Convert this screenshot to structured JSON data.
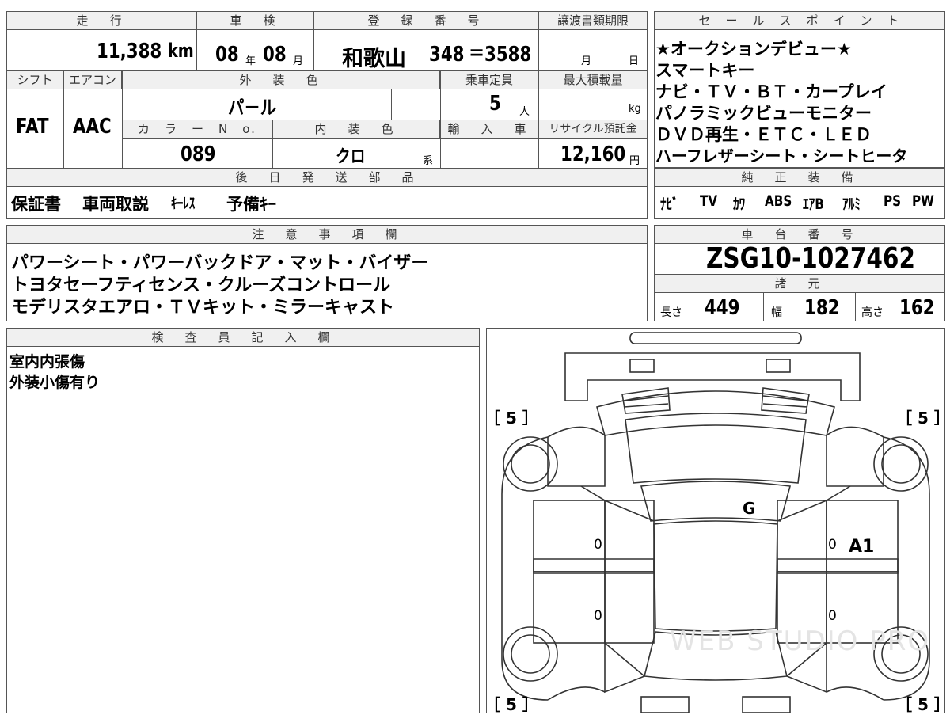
{
  "top": {
    "mileage_hdr": "走　行",
    "mileage": "11,388",
    "mileage_unit": "km",
    "inspection_hdr": "車　検",
    "insp_year": "08",
    "insp_year_unit": "年",
    "insp_month": "08",
    "insp_month_unit": "月",
    "reg_hdr": "登　録　番　号",
    "reg_area": "和歌山",
    "reg_class": "348",
    "reg_sep": "=",
    "reg_number": "3588",
    "transfer_hdr": "譲渡書類期限",
    "transfer_month": "月",
    "transfer_day": "日",
    "shift_hdr": "シフト",
    "shift": "FAT",
    "ac_hdr": "エアコン",
    "ac": "AAC",
    "exterior_hdr": "外　装　色",
    "exterior": "パ－ル",
    "capacity_hdr": "乗車定員",
    "capacity": "5",
    "capacity_unit": "人",
    "maxload_hdr": "最大積載量",
    "maxload_unit": "kg",
    "color_no_hdr": "カ　ラ　ー　N　o.",
    "color_no": "089",
    "interior_hdr": "内　装　色",
    "interior": "クロ",
    "interior_unit": "系",
    "import_hdr": "輸　入　車",
    "recycle_hdr": "リサイクル預託金",
    "recycle": "12,160",
    "recycle_unit": "円",
    "later_parts_hdr": "後　日　発　送　部　品",
    "later_parts": [
      "保証書",
      "車両取説",
      "ｷｰﾚｽ",
      "予備ｷｰ"
    ]
  },
  "sales": {
    "hdr": "セ　ー　ル　ス　ポ　イ　ン　ト",
    "lines": [
      "★オークションデビュー★",
      "スマートキー",
      "ナビ・ＴＶ・ＢＴ・カープレイ",
      "パノラミックビューモニター",
      "ＤＶＤ再生・ＥＴＣ・ＬＥＤ",
      "ハーフレザーシート・シートヒータ"
    ]
  },
  "equipment": {
    "hdr": "純　正　装　備",
    "items": [
      "ﾅﾋﾞ",
      "TV",
      "ｶﾜ",
      "ABS",
      "ｴｱB",
      "ｱﾙﾐ",
      "PS",
      "PW"
    ]
  },
  "notes": {
    "hdr": "注　意　事　項　欄",
    "lines": [
      "パワーシート・パワーバックドア・マット・バイザー",
      "トヨタセーフティセンス・クルーズコントロール",
      "モデリスタエアロ・ＴＶキット・ミラーキャスト"
    ]
  },
  "chassis": {
    "hdr": "車　台　番　号",
    "number": "ZSG10-1027462"
  },
  "specs": {
    "hdr": "諸　元",
    "length_label": "長さ",
    "length": "449",
    "width_label": "幅",
    "width": "182",
    "height_label": "高さ",
    "height": "162"
  },
  "inspector": {
    "hdr": "検　査　員　記　入　欄",
    "lines": [
      "室内内張傷",
      "外装小傷有り"
    ]
  },
  "diagram": {
    "tire_fl": "［ 5 ］",
    "tire_fr": "［ 5 ］",
    "tire_rl": "［ 5 ］",
    "tire_rr": "［ 5 ］",
    "mark_g": "G",
    "mark_a1": "A1",
    "mark_0a": "0",
    "mark_0b": "0",
    "mark_0c": "0",
    "mark_0d": "0",
    "watermark": "WEB STUDIO PRO"
  }
}
